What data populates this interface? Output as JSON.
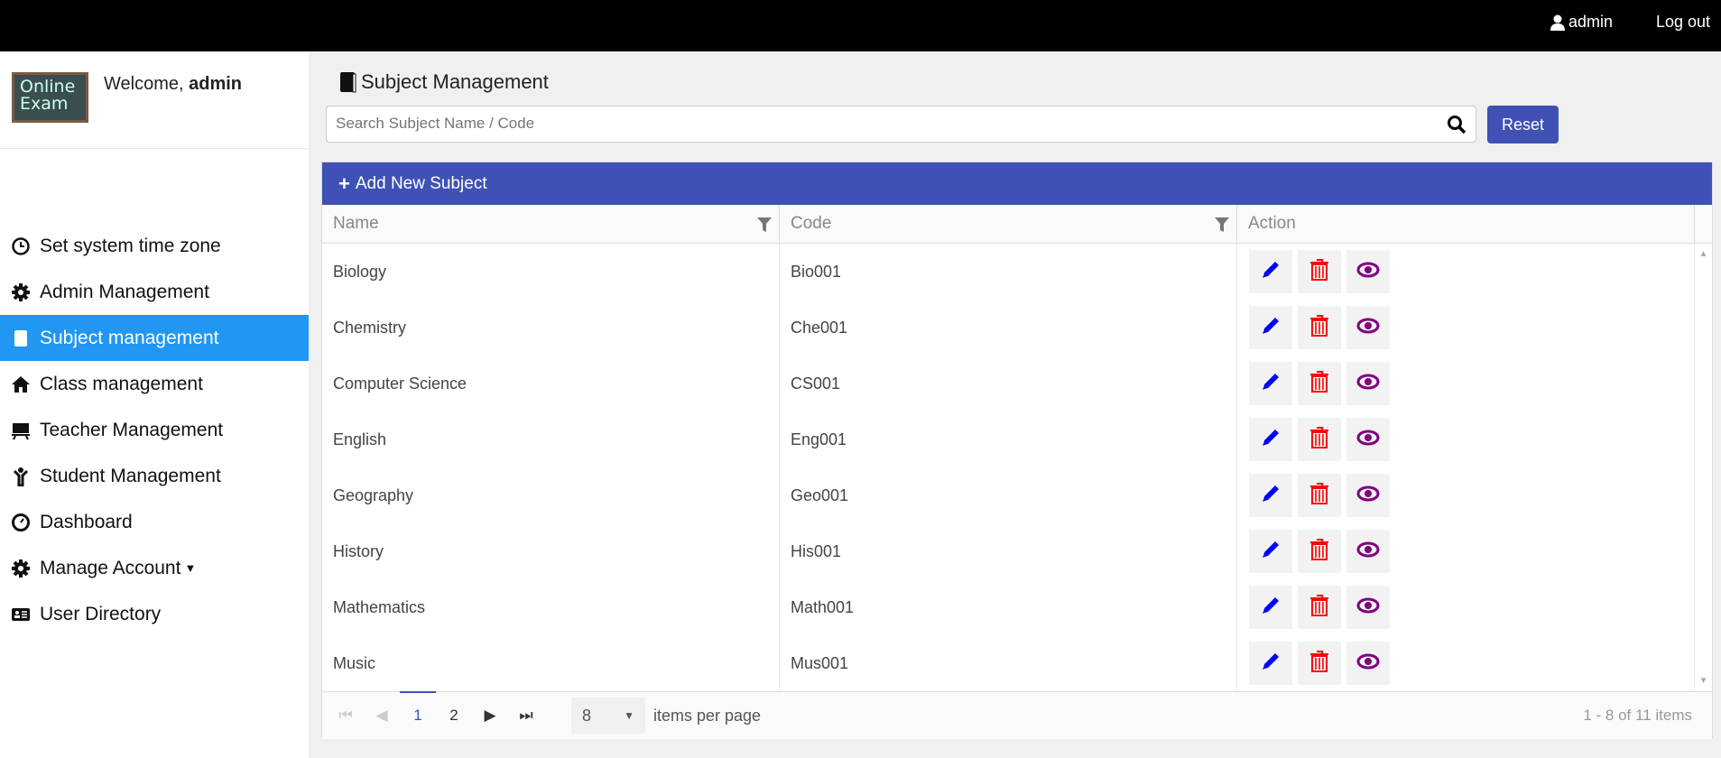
{
  "topbar": {
    "user": "admin",
    "logout": "Log out"
  },
  "sidebar": {
    "logo": "Online Exam",
    "welcome_prefix": "Welcome, ",
    "welcome_user": "admin",
    "items": [
      {
        "label": "Set system time zone",
        "icon": "clock-icon"
      },
      {
        "label": "Admin Management",
        "icon": "gear-icon"
      },
      {
        "label": "Subject management",
        "icon": "book-icon",
        "active": true
      },
      {
        "label": "Class management",
        "icon": "home-icon"
      },
      {
        "label": "Teacher Management",
        "icon": "presentation-icon"
      },
      {
        "label": "Student Management",
        "icon": "child-icon"
      },
      {
        "label": "Dashboard",
        "icon": "dashboard-icon"
      },
      {
        "label": "Manage Account",
        "icon": "gear-icon"
      },
      {
        "label": "User Directory",
        "icon": "id-card-icon"
      }
    ]
  },
  "main": {
    "title": "Subject Management",
    "search_placeholder": "Search Subject Name / Code",
    "reset": "Reset",
    "add": "Add New Subject",
    "columns": [
      "Name",
      "Code",
      "Action"
    ],
    "rows": [
      {
        "name": "Biology",
        "code": "Bio001"
      },
      {
        "name": "Chemistry",
        "code": "Che001"
      },
      {
        "name": "Computer Science",
        "code": "CS001"
      },
      {
        "name": "English",
        "code": "Eng001"
      },
      {
        "name": "Geography",
        "code": "Geo001"
      },
      {
        "name": "History",
        "code": "His001"
      },
      {
        "name": "Mathematics",
        "code": "Math001"
      },
      {
        "name": "Music",
        "code": "Mus001"
      }
    ],
    "pager": {
      "pages": [
        "1",
        "2"
      ],
      "current": "1",
      "page_size": "8",
      "per_page_label": "items per page",
      "info": "1 - 8 of 11 items"
    }
  },
  "colors": {
    "accent": "#3f51b5",
    "active": "#2196f3",
    "edit": "#0000ff",
    "delete": "#ff0000",
    "view": "#800080"
  }
}
